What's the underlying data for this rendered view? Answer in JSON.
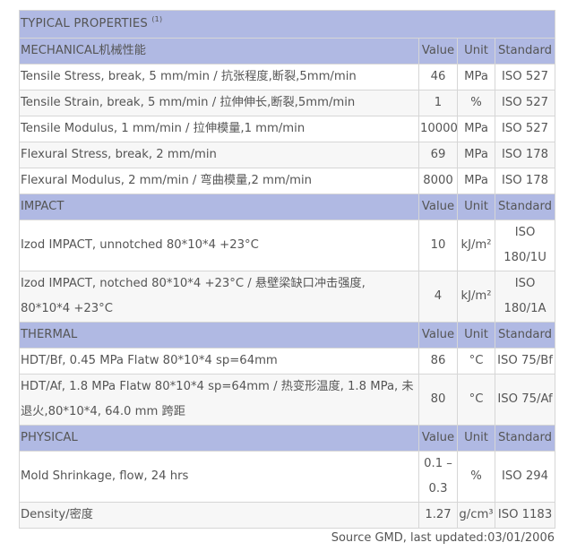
{
  "title": {
    "text": "TYPICAL PROPERTIES",
    "note": "(1)"
  },
  "sections": [
    {
      "name": "MECHANICAL机械性能",
      "headers": {
        "value": "Value",
        "unit": "Unit",
        "standard": "Standard"
      },
      "rows": [
        {
          "property": "Tensile Stress, break, 5 mm/min / 抗张程度,断裂,5mm/min",
          "value": "46",
          "unit": "MPa",
          "standard": "ISO 527"
        },
        {
          "property": "Tensile Strain, break, 5 mm/min / 拉伸伸长,断裂,5mm/min",
          "value": "1",
          "unit": "%",
          "standard": "ISO 527"
        },
        {
          "property": "Tensile Modulus, 1 mm/min / 拉伸模量,1 mm/min",
          "value": "10000",
          "unit": "MPa",
          "standard": "ISO 527"
        },
        {
          "property": "Flexural Stress, break, 2 mm/min",
          "value": "69",
          "unit": "MPa",
          "standard": "ISO 178"
        },
        {
          "property": "Flexural Modulus, 2 mm/min / 弯曲模量,2 mm/min",
          "value": "8000",
          "unit": "MPa",
          "standard": "ISO 178"
        }
      ]
    },
    {
      "name": "IMPACT",
      "headers": {
        "value": "Value",
        "unit": "Unit",
        "standard": "Standard"
      },
      "rows": [
        {
          "property": "Izod IMPACT, unnotched 80*10*4 +23°C",
          "value": "10",
          "unit": "kJ/m²",
          "standard": "ISO 180/1U"
        },
        {
          "property": "Izod IMPACT, notched 80*10*4 +23°C / 悬壁梁缺口冲击强度, 80*10*4 +23°C",
          "value": "4",
          "unit": "kJ/m²",
          "standard": "ISO 180/1A"
        }
      ]
    },
    {
      "name": "THERMAL",
      "headers": {
        "value": "Value",
        "unit": "Unit",
        "standard": "Standard"
      },
      "rows": [
        {
          "property": "HDT/Bf, 0.45 MPa Flatw 80*10*4 sp=64mm",
          "value": "86",
          "unit": "°C",
          "standard": "ISO 75/Bf"
        },
        {
          "property": "HDT/Af, 1.8 MPa Flatw 80*10*4 sp=64mm / 热变形温度, 1.8 MPa, 未退火,80*10*4, 64.0 mm 跨距",
          "value": "80",
          "unit": "°C",
          "standard": "ISO 75/Af"
        }
      ]
    },
    {
      "name": "PHYSICAL",
      "headers": {
        "value": "Value",
        "unit": "Unit",
        "standard": "Standard"
      },
      "rows": [
        {
          "property": "Mold Shrinkage, flow, 24 hrs",
          "value": "0.1 – 0.3",
          "unit": "%",
          "standard": "ISO 294"
        },
        {
          "property": "Density/密度",
          "value": "1.27",
          "unit": "g/cm³",
          "standard": "ISO 1183"
        }
      ]
    }
  ],
  "source": "Source GMD, last updated:03/01/2006"
}
